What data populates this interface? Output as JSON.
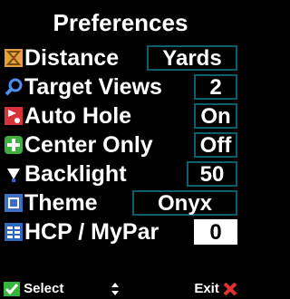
{
  "title": "Preferences",
  "settings": [
    {
      "icon": "flag-distance-icon",
      "label": "Distance",
      "value": "Yards",
      "selected": false,
      "color": "#e6a23a"
    },
    {
      "icon": "magnifier-icon",
      "label": "Target Views",
      "value": "2",
      "selected": false,
      "color": "#3a7fe0"
    },
    {
      "icon": "auto-hole-icon",
      "label": "Auto Hole",
      "value": "On",
      "selected": false,
      "color": "#d8333a"
    },
    {
      "icon": "center-plus-icon",
      "label": "Center Only",
      "value": "Off",
      "selected": false,
      "color": "#3fae3f"
    },
    {
      "icon": "backlight-bulb-icon",
      "label": "Backlight",
      "value": "50",
      "selected": false,
      "color": "#2f66c4"
    },
    {
      "icon": "theme-icon",
      "label": "Theme",
      "value": "Onyx",
      "selected": false,
      "color": "#3f6fc2"
    },
    {
      "icon": "hcp-grid-icon",
      "label": "HCP / MyPar",
      "value": "0",
      "selected": true,
      "color": "#2f66c4"
    }
  ],
  "footer": {
    "select_label": "Select",
    "exit_label": "Exit"
  },
  "colors": {
    "value_border": "#0d5f70",
    "check": "#37b43a",
    "exit_x": "#e03030"
  }
}
